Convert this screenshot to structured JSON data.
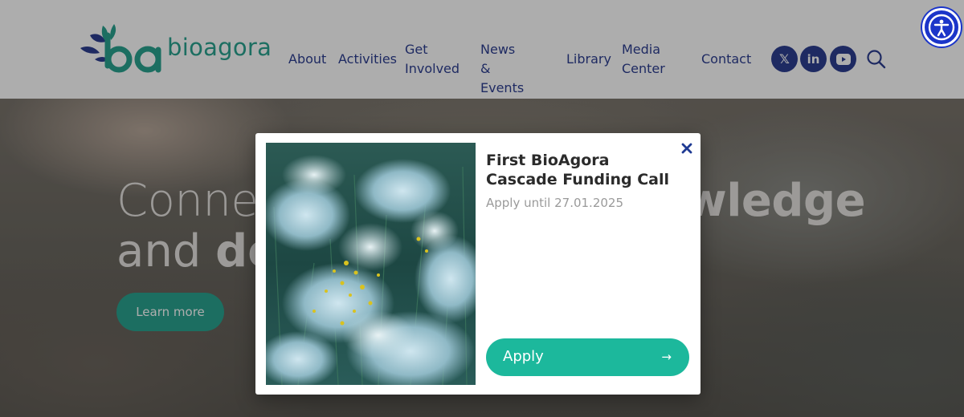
{
  "header": {
    "logo_text": "bioagora",
    "nav": [
      {
        "label": "About"
      },
      {
        "label": "Activities"
      },
      {
        "label": "Get\nInvolved"
      },
      {
        "label": "News &\nEvents"
      },
      {
        "label": "Library"
      },
      {
        "label": "Media\nCenter"
      },
      {
        "label": "Contact"
      }
    ],
    "social": [
      {
        "icon": "x-twitter-icon",
        "glyph": "𝕏"
      },
      {
        "icon": "linkedin-icon",
        "glyph": "in"
      },
      {
        "icon": "youtube-icon",
        "glyph": "▶"
      }
    ],
    "search_icon": "search-icon"
  },
  "accessibility": {
    "icon": "accessibility-icon"
  },
  "hero": {
    "line1_start": "Connec",
    "line1_end": "wledge",
    "line2_start": "and ",
    "line2_bold": "de",
    "cta_label": "Learn more"
  },
  "modal": {
    "title": "First BioAgora Cascade Funding Call",
    "subtitle": "Apply until 27.01.2025",
    "apply_label": "Apply",
    "apply_arrow": "→",
    "close_icon": "close-icon"
  },
  "colors": {
    "brand_teal": "#2aa38f",
    "nav_blue": "#2d3e91",
    "apply_green": "#1cb89c",
    "a11y_blue": "#1b35c9"
  }
}
